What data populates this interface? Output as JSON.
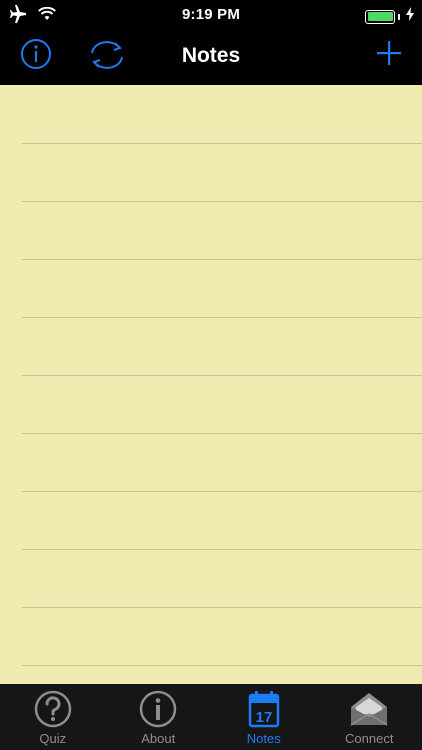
{
  "status_bar": {
    "time": "9:19 PM",
    "icons": [
      "airplane-icon",
      "wifi-icon",
      "battery-icon",
      "charging-icon"
    ],
    "battery_color": "#4cd964"
  },
  "nav_bar": {
    "title": "Notes",
    "buttons": [
      "info-icon",
      "refresh-icon",
      "add-icon"
    ],
    "accent_color": "#1e7cf2"
  },
  "notes": {
    "paper_color": "#f0eab0",
    "rule_color": "#c9c391"
  },
  "tab_bar": {
    "tabs": [
      {
        "label": "Quiz",
        "icon": "question-circle-icon",
        "active": false
      },
      {
        "label": "About",
        "icon": "info-circle-icon",
        "active": false
      },
      {
        "label": "Notes",
        "icon": "calendar-icon",
        "active": true
      },
      {
        "label": "Connect",
        "icon": "envelope-icon",
        "active": false
      }
    ],
    "calendar_day": "17",
    "active_color": "#1e7cf2",
    "inactive_color": "#8e8e8e"
  }
}
